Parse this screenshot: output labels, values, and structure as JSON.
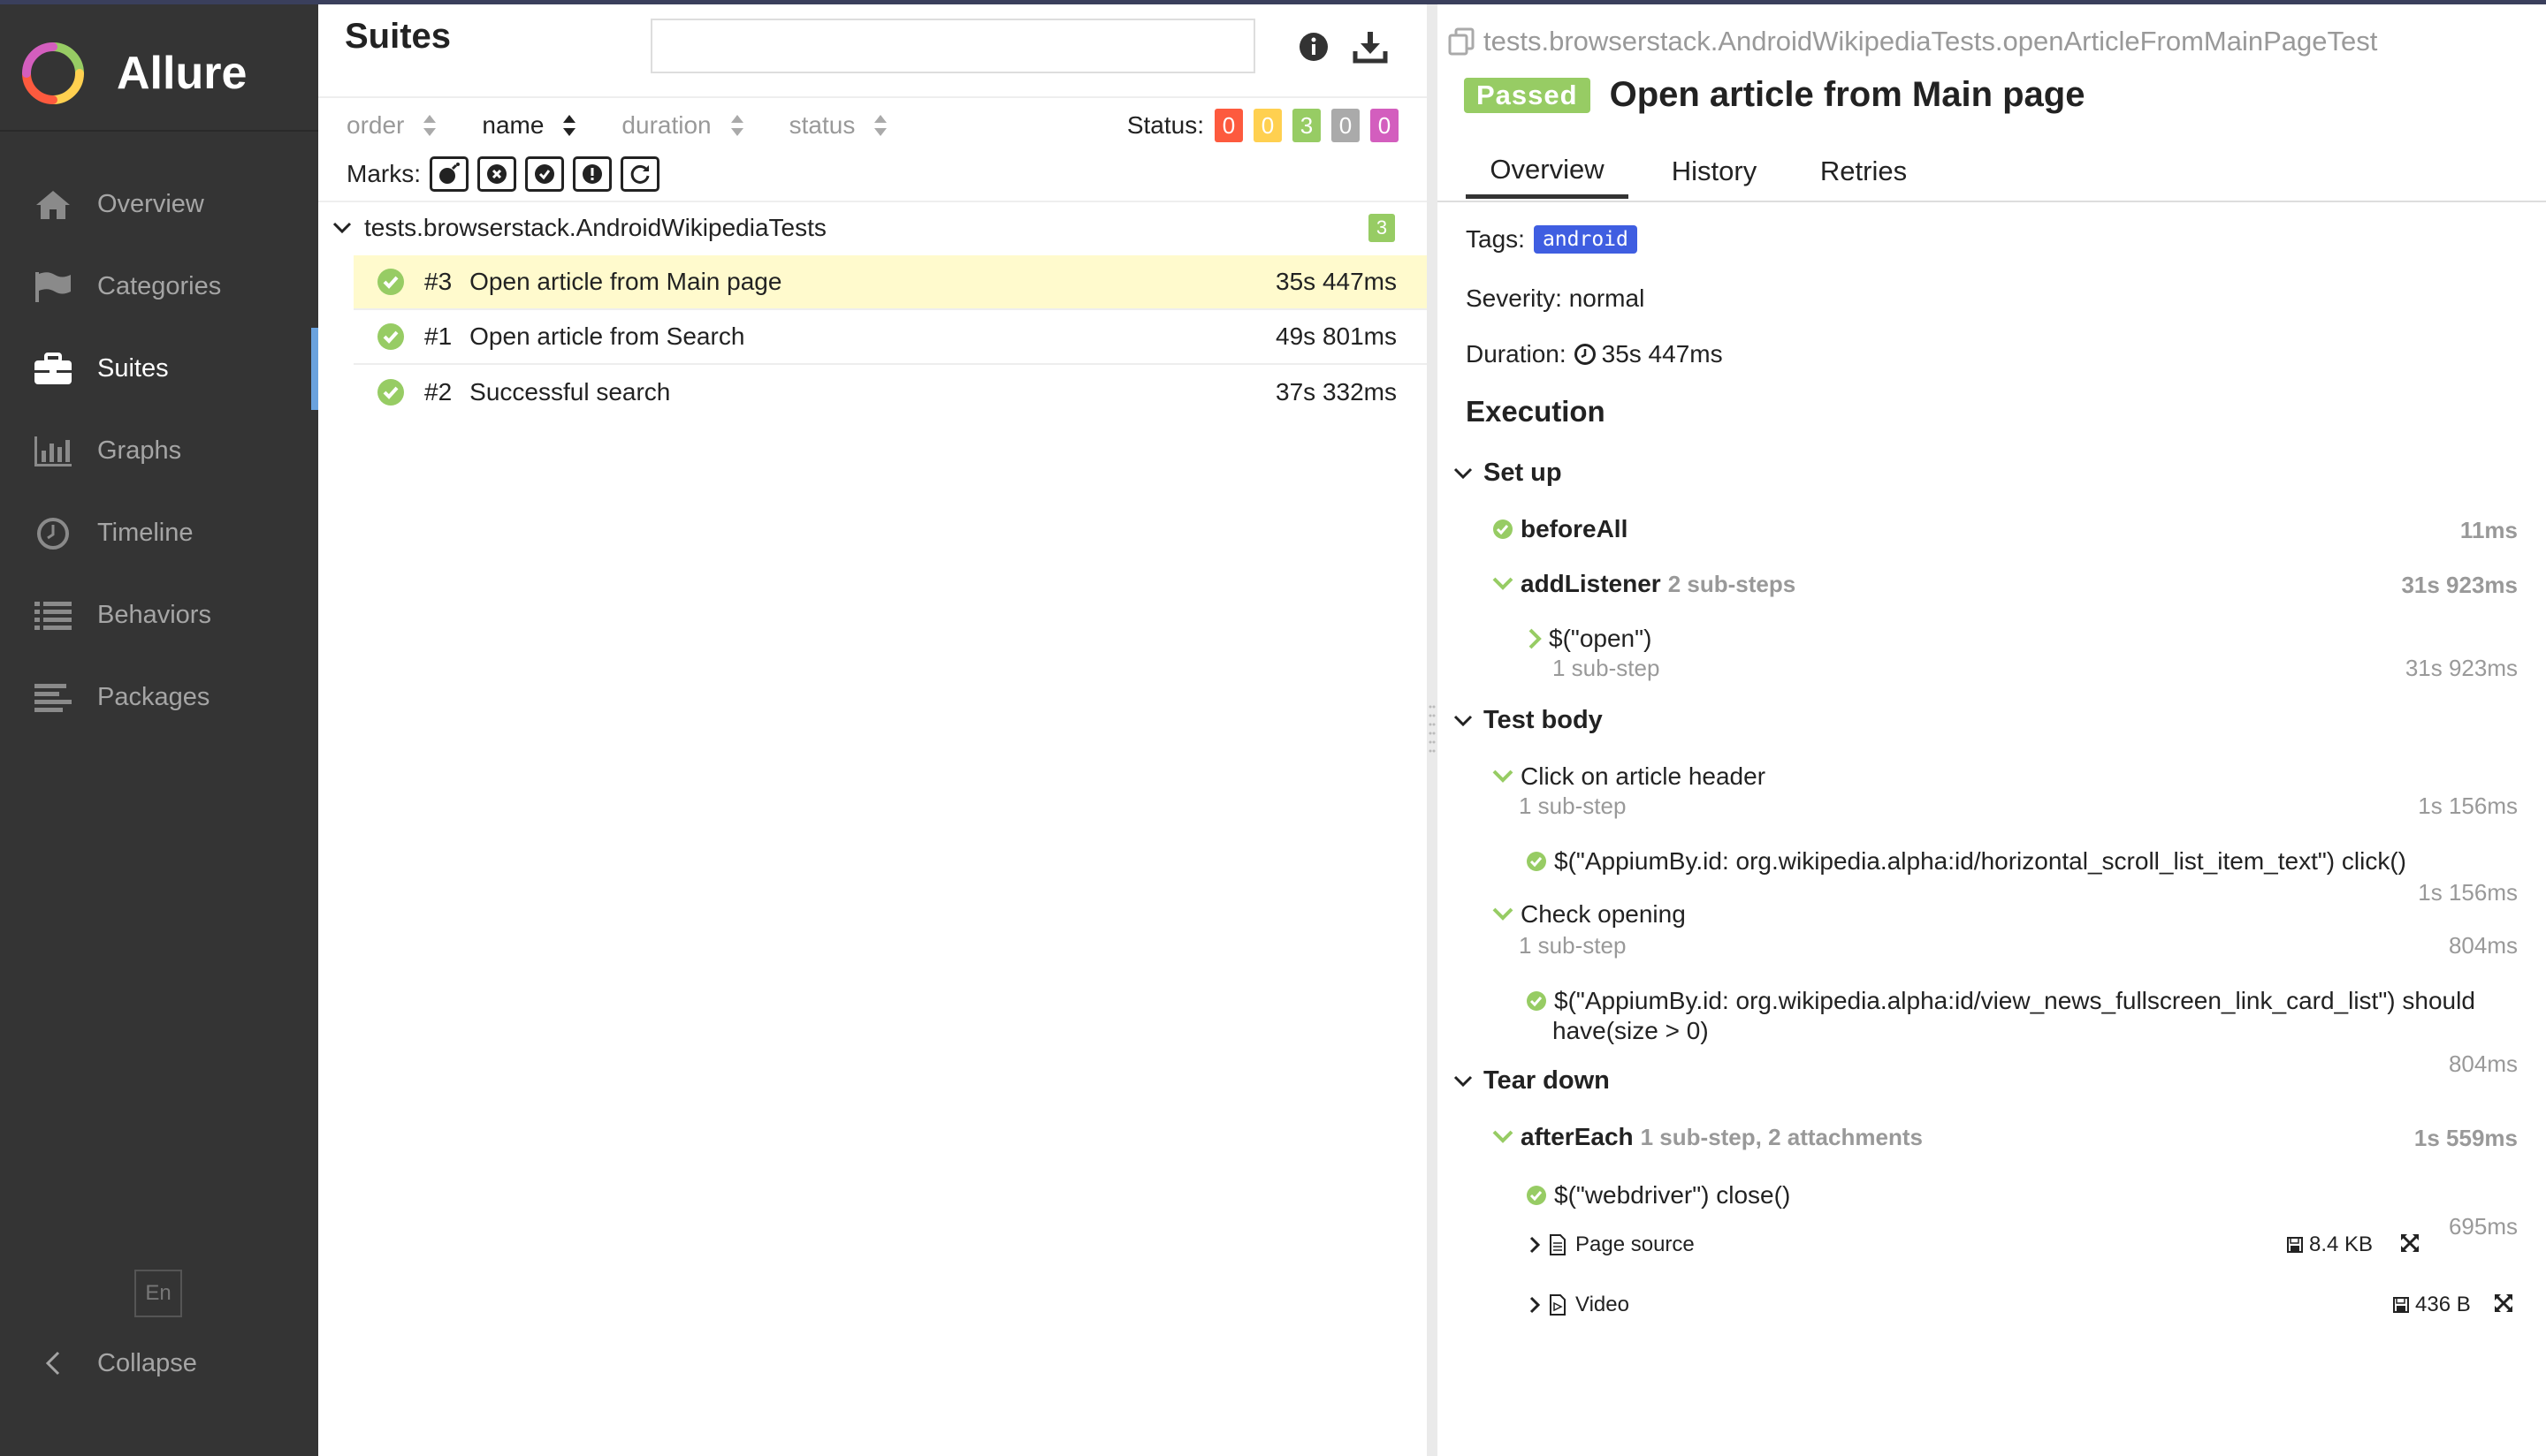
{
  "app": {
    "name": "Allure"
  },
  "sidebar": {
    "items": [
      {
        "label": "Overview",
        "icon": "home-icon"
      },
      {
        "label": "Categories",
        "icon": "flag-icon"
      },
      {
        "label": "Suites",
        "icon": "briefcase-icon",
        "active": true
      },
      {
        "label": "Graphs",
        "icon": "bar-chart-icon"
      },
      {
        "label": "Timeline",
        "icon": "clock-icon"
      },
      {
        "label": "Behaviors",
        "icon": "list-icon"
      },
      {
        "label": "Packages",
        "icon": "align-left-icon"
      }
    ],
    "language": "En",
    "collapse_label": "Collapse"
  },
  "suites": {
    "title": "Suites",
    "search_value": "",
    "sort": {
      "order": "order",
      "name": "name",
      "duration": "duration",
      "status": "status",
      "active": "name"
    },
    "status_label": "Status:",
    "status_counts": [
      {
        "value": "0",
        "color": "#fd5a3e"
      },
      {
        "value": "0",
        "color": "#ffd050"
      },
      {
        "value": "3",
        "color": "#97cc64"
      },
      {
        "value": "0",
        "color": "#aaaaaa"
      },
      {
        "value": "0",
        "color": "#d35ebe"
      }
    ],
    "marks_label": "Marks:",
    "group": {
      "name": "tests.browserstack.AndroidWikipediaTests",
      "count": "3"
    },
    "rows": [
      {
        "num": "#3",
        "name": "Open article from Main page",
        "duration": "35s 447ms"
      },
      {
        "num": "#1",
        "name": "Open article from Search",
        "duration": "49s 801ms"
      },
      {
        "num": "#2",
        "name": "Successful search",
        "duration": "37s 332ms"
      }
    ]
  },
  "detail": {
    "full_name": "tests.browserstack.AndroidWikipediaTests.openArticleFromMainPageTest",
    "status": "Passed",
    "title": "Open article from Main page",
    "tabs": [
      "Overview",
      "History",
      "Retries"
    ],
    "tags_label": "Tags:",
    "tag": "android",
    "severity": "Severity: normal",
    "duration_label": "Duration:",
    "duration": "35s 447ms",
    "execution_title": "Execution",
    "setup": {
      "title": "Set up",
      "before_all": {
        "name": "beforeAll",
        "duration": "11ms"
      },
      "add_listener": {
        "name": "addListener",
        "meta": "2 sub-steps",
        "duration": "31s 923ms"
      },
      "open": {
        "name": "$(\"open\")",
        "meta": "1 sub-step",
        "duration": "31s 923ms"
      }
    },
    "body": {
      "title": "Test body",
      "click": {
        "name": "Click on article header",
        "meta": "1 sub-step",
        "duration": "1s 156ms"
      },
      "click_sub": {
        "name": "$(\"AppiumBy.id: org.wikipedia.alpha:id/horizontal_scroll_list_item_text\") click()",
        "duration": "1s 156ms"
      },
      "check": {
        "name": "Check opening",
        "meta": "1 sub-step",
        "duration": "804ms"
      },
      "check_sub_line1": "$(\"AppiumBy.id: org.wikipedia.alpha:id/view_news_fullscreen_link_card_list\") should",
      "check_sub_line2": "have(size > 0)",
      "check_sub_duration": "804ms"
    },
    "teardown": {
      "title": "Tear down",
      "after_each": {
        "name": "afterEach",
        "meta": "1 sub-step, 2 attachments",
        "duration": "1s 559ms"
      },
      "close": {
        "name": "$(\"webdriver\") close()",
        "duration": "695ms"
      },
      "attachments": [
        {
          "name": "Page source",
          "size": "8.4 KB"
        },
        {
          "name": "Video",
          "size": "436 B"
        }
      ]
    }
  }
}
